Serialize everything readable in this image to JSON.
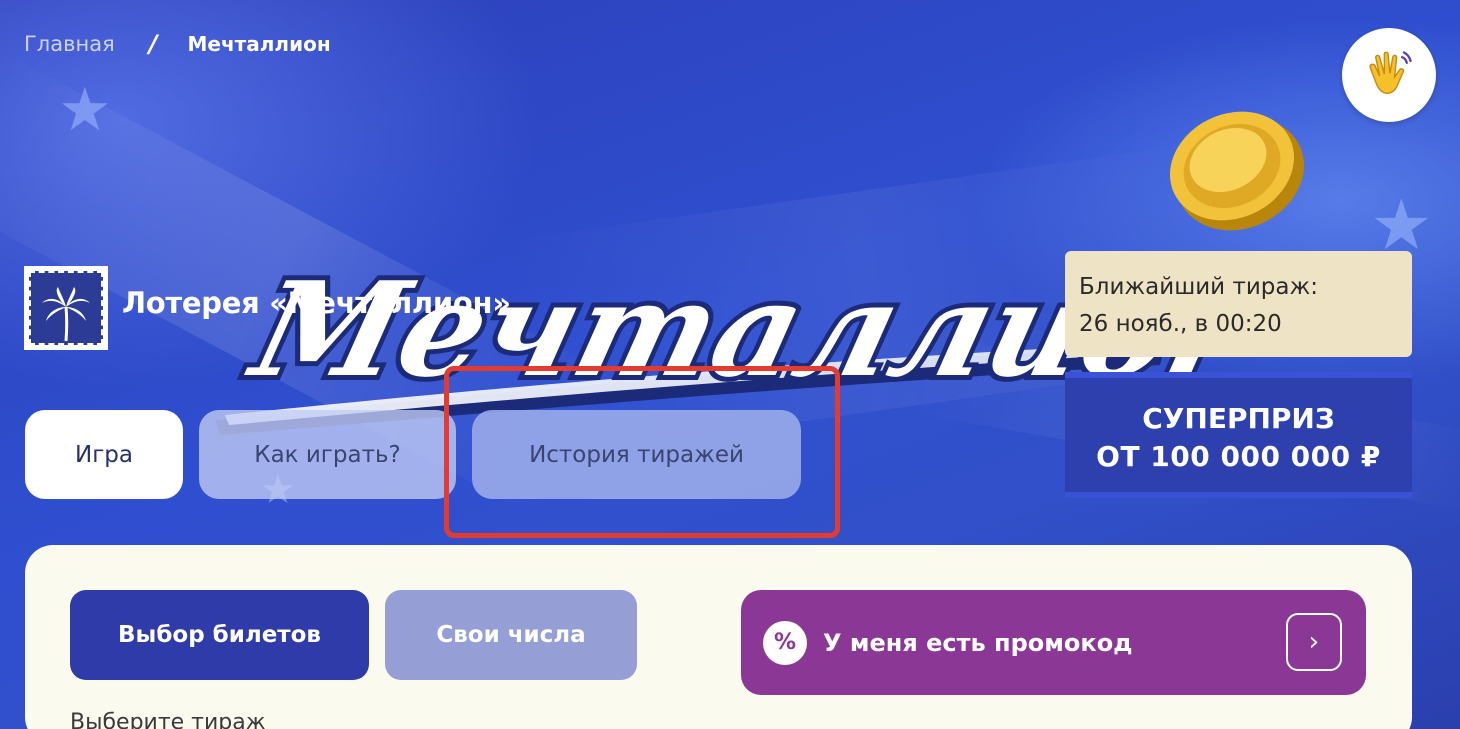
{
  "breadcrumb": {
    "home": "Главная",
    "separator": "/",
    "current": "Мечталлион"
  },
  "header": {
    "wave_icon": "waving-hand-icon"
  },
  "hero": {
    "logo_text": "Мечталлион",
    "lottery_title": "Лотерея «Мечталлион»"
  },
  "tabs": [
    {
      "label": "Игра",
      "active": true
    },
    {
      "label": "Как играть?",
      "active": false
    },
    {
      "label": "История тиражей",
      "active": false,
      "highlighted": true
    }
  ],
  "draw_info": {
    "line1": "Ближайший тираж:",
    "line2": "26 нояб., в 00:20"
  },
  "superprize": {
    "line1": "СУПЕРПРИЗ",
    "line2": "ОТ 100 000 000 ₽"
  },
  "panel": {
    "tickets_button": "Выбор билетов",
    "numbers_button": "Свои числа",
    "promo_label": "У меня есть промокод",
    "promo_icon": "%",
    "promo_arrow": "›",
    "select_draw": "Выберите тираж"
  },
  "colors": {
    "hero_blue": "#2f47c4",
    "highlight_red": "#e33b2f",
    "tickets_button": "#2f3ba8",
    "promo_purple": "#8b3796",
    "draw_card": "#efe3c5"
  }
}
